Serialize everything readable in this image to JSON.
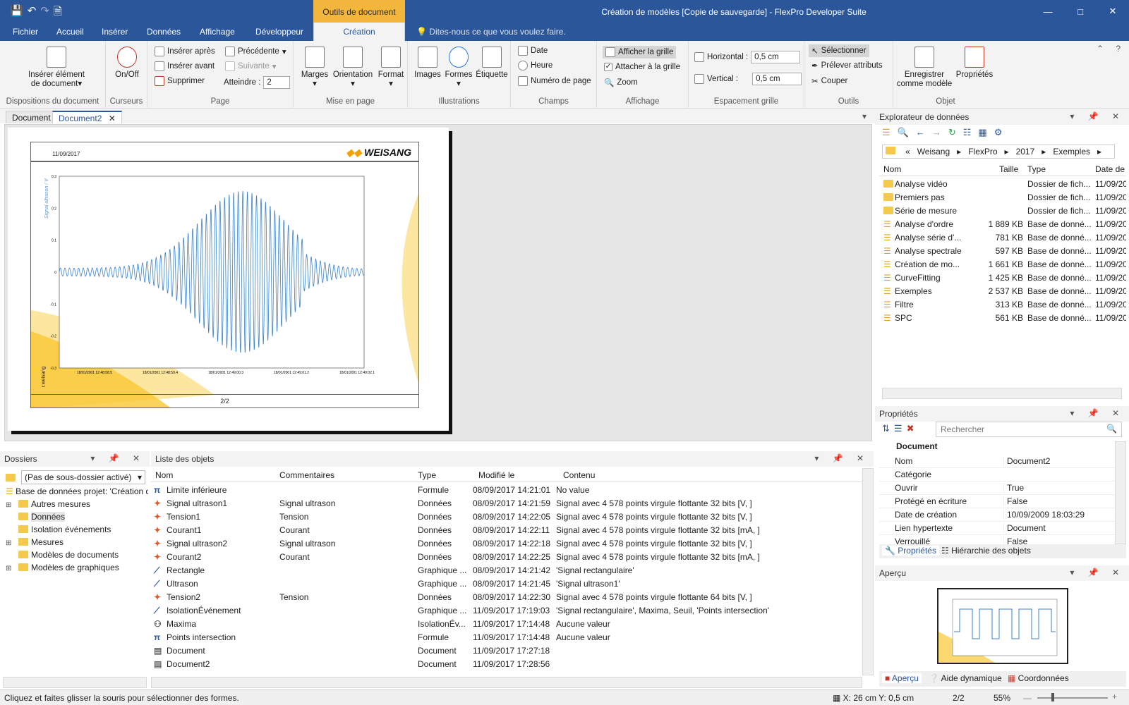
{
  "title_bar": {
    "title": "Création de modèles [Copie de sauvegarde] - FlexPro Developer Suite",
    "context_tab_group": "Outils de document"
  },
  "menu": {
    "items": [
      "Fichier",
      "Accueil",
      "Insérer",
      "Données",
      "Affichage",
      "Développeur"
    ],
    "active": "Création",
    "tell_me": "Dites-nous ce que vous voulez faire."
  },
  "ribbon": {
    "groups": {
      "dispositions": "Dispositions du document",
      "curseurs": "Curseurs",
      "page": "Page",
      "mise_en_page": "Mise en page",
      "illustrations": "Illustrations",
      "champs": "Champs",
      "affichage": "Affichage",
      "espacement": "Espacement grille",
      "outils": "Outils",
      "objet": "Objet"
    },
    "inserer_element": "Insérer élément",
    "de_document": "de document",
    "onoff": "On/Off",
    "inserer_apres": "Insérer après",
    "inserer_avant": "Insérer avant",
    "supprimer": "Supprimer",
    "precedente": "Précédente",
    "suivante": "Suivante",
    "atteindre": "Atteindre :",
    "atteindre_val": "2",
    "marges": "Marges",
    "orientation": "Orientation",
    "format": "Format",
    "images": "Images",
    "formes": "Formes",
    "etiquette": "Étiquette",
    "date": "Date",
    "heure": "Heure",
    "numero_page": "Numéro de page",
    "afficher_grille": "Afficher la grille",
    "attacher_grille": "Attacher à la grille",
    "zoom": "Zoom",
    "horizontal": "Horizontal :",
    "horizontal_val": "0,5 cm",
    "vertical": "Vertical :",
    "vertical_val": "0,5 cm",
    "selectionner": "Sélectionner",
    "prelever": "Prélever attributs",
    "couper": "Couper",
    "enregistrer": "Enregistrer",
    "comme_modele": "comme modèle",
    "proprietes": "Propriétés"
  },
  "doc_tabs": [
    "Document",
    "Document2"
  ],
  "document_page": {
    "date": "11/09/2017",
    "logo": "WEISANG",
    "page_number": "2/2",
    "side_text": "r.weisang",
    "y_axis_label": "Signal ultrason / V",
    "y_ticks": [
      "0.3",
      "0.2",
      "0.1",
      "0",
      "-0.1",
      "-0.2",
      "-0.3"
    ],
    "x_ticks": [
      "18/01/2001 12:48:58.5",
      "18/01/2001 12:48:59.4",
      "18/01/2001 12:49:00.3",
      "18/01/2001 12:49:01.2",
      "18/01/2001 12:49:02.1"
    ]
  },
  "data_explorer": {
    "title": "Explorateur de données",
    "path": [
      "«",
      "Weisang",
      "FlexPro",
      "2017",
      "Exemples"
    ],
    "columns": [
      "Nom",
      "Taille",
      "Type",
      "Date de"
    ],
    "rows": [
      {
        "name": "Analyse vidéo",
        "size": "",
        "type": "Dossier de fich...",
        "date": "11/09/20",
        "folder": true
      },
      {
        "name": "Premiers pas",
        "size": "",
        "type": "Dossier de fich...",
        "date": "11/09/20",
        "folder": true
      },
      {
        "name": "Série de mesure",
        "size": "",
        "type": "Dossier de fich...",
        "date": "11/09/20",
        "folder": true
      },
      {
        "name": "Analyse d'ordre",
        "size": "1 889 KB",
        "type": "Base de donné...",
        "date": "11/09/20",
        "folder": false
      },
      {
        "name": "Analyse série d'...",
        "size": "781 KB",
        "type": "Base de donné...",
        "date": "11/09/20",
        "folder": false
      },
      {
        "name": "Analyse spectrale",
        "size": "597 KB",
        "type": "Base de donné...",
        "date": "11/09/20",
        "folder": false
      },
      {
        "name": "Création de mo...",
        "size": "1 661 KB",
        "type": "Base de donné...",
        "date": "11/09/20",
        "folder": false
      },
      {
        "name": "CurveFitting",
        "size": "1 425 KB",
        "type": "Base de donné...",
        "date": "11/09/20",
        "folder": false
      },
      {
        "name": "Exemples",
        "size": "2 537 KB",
        "type": "Base de donné...",
        "date": "11/09/20",
        "folder": false
      },
      {
        "name": "Filtre",
        "size": "313 KB",
        "type": "Base de donné...",
        "date": "11/09/20",
        "folder": false
      },
      {
        "name": "SPC",
        "size": "561 KB",
        "type": "Base de donné...",
        "date": "11/09/20",
        "folder": false
      }
    ]
  },
  "properties": {
    "title": "Propriétés",
    "search_placeholder": "Rechercher",
    "section": "Document",
    "rows": [
      {
        "k": "Nom",
        "v": "Document2"
      },
      {
        "k": "Catégorie",
        "v": ""
      },
      {
        "k": "Ouvrir",
        "v": "True"
      },
      {
        "k": "Protégé en écriture",
        "v": "False"
      },
      {
        "k": "Date de création",
        "v": "10/09/2009 18:03:29"
      },
      {
        "k": "Lien hypertexte",
        "v": "Document"
      },
      {
        "k": "Verrouillé",
        "v": "False"
      }
    ],
    "tab_props": "Propriétés",
    "tab_hier": "Hiérarchie des objets"
  },
  "apercu": {
    "title": "Aperçu",
    "tab_apercu": "Aperçu",
    "tab_aide": "Aide dynamique",
    "tab_coord": "Coordonnées"
  },
  "folders": {
    "title": "Dossiers",
    "combo": "(Pas de sous-dossier activé)",
    "root": "Base de données projet: 'Création d",
    "items": [
      {
        "label": "Autres mesures",
        "expand": true
      },
      {
        "label": "Données",
        "expand": false
      },
      {
        "label": "Isolation événements",
        "expand": false
      },
      {
        "label": "Mesures",
        "expand": true
      },
      {
        "label": "Modèles de documents",
        "expand": false
      },
      {
        "label": "Modèles de graphiques",
        "expand": true
      }
    ]
  },
  "objects": {
    "title": "Liste des objets",
    "columns": [
      "Nom",
      "Commentaires",
      "Type",
      "Modifié le",
      "Contenu"
    ],
    "rows": [
      {
        "icon": "pi",
        "name": "Limite inférieure",
        "comment": "",
        "type": "Formule",
        "mod": "08/09/2017 14:21:01",
        "content": "No value"
      },
      {
        "icon": "sig",
        "name": "Signal ultrason1",
        "comment": "Signal ultrason",
        "type": "Données",
        "mod": "08/09/2017 14:21:59",
        "content": "Signal avec 4 578 points virgule flottante 32 bits [V, ]"
      },
      {
        "icon": "sig",
        "name": "Tension1",
        "comment": "Tension",
        "type": "Données",
        "mod": "08/09/2017 14:22:05",
        "content": "Signal avec 4 578 points virgule flottante 32 bits [V, ]"
      },
      {
        "icon": "sig",
        "name": "Courant1",
        "comment": "Courant",
        "type": "Données",
        "mod": "08/09/2017 14:22:11",
        "content": "Signal avec 4 578 points virgule flottante 32 bits [mA, ]"
      },
      {
        "icon": "sig",
        "name": "Signal ultrason2",
        "comment": "Signal ultrason",
        "type": "Données",
        "mod": "08/09/2017 14:22:18",
        "content": "Signal avec 4 578 points virgule flottante 32 bits [V, ]"
      },
      {
        "icon": "sig",
        "name": "Courant2",
        "comment": "Courant",
        "type": "Données",
        "mod": "08/09/2017 14:22:25",
        "content": "Signal avec 4 578 points virgule flottante 32 bits [mA, ]"
      },
      {
        "icon": "graph",
        "name": "Rectangle",
        "comment": "",
        "type": "Graphique ...",
        "mod": "08/09/2017 14:21:42",
        "content": "'Signal rectangulaire'"
      },
      {
        "icon": "graph",
        "name": "Ultrason",
        "comment": "",
        "type": "Graphique ...",
        "mod": "08/09/2017 14:21:45",
        "content": "'Signal ultrason1'"
      },
      {
        "icon": "sig",
        "name": "Tension2",
        "comment": "Tension",
        "type": "Données",
        "mod": "08/09/2017 14:22:30",
        "content": "Signal avec 4 578 points virgule flottante 64 bits [V, ]"
      },
      {
        "icon": "graph",
        "name": "IsolationÉvénement",
        "comment": "",
        "type": "Graphique ...",
        "mod": "11/09/2017 17:19:03",
        "content": "'Signal rectangulaire', Maxima, Seuil, 'Points intersection'"
      },
      {
        "icon": "iso",
        "name": "Maxima",
        "comment": "",
        "type": "IsolationÉv...",
        "mod": "11/09/2017 17:14:48",
        "content": "Aucune valeur"
      },
      {
        "icon": "pi",
        "name": "Points intersection",
        "comment": "",
        "type": "Formule",
        "mod": "11/09/2017 17:14:48",
        "content": "Aucune valeur"
      },
      {
        "icon": "doc",
        "name": "Document",
        "comment": "",
        "type": "Document",
        "mod": "11/09/2017 17:27:18",
        "content": ""
      },
      {
        "icon": "doc",
        "name": "Document2",
        "comment": "",
        "type": "Document",
        "mod": "11/09/2017 17:28:56",
        "content": ""
      }
    ]
  },
  "status": {
    "hint": "Cliquez et faites glisser la souris pour sélectionner des formes.",
    "coords": "X: 26 cm Y: 0,5 cm",
    "page": "2/2",
    "zoom": "55%"
  },
  "colors": {
    "accent": "#2b579a",
    "context": "#f2b63c",
    "signal": "#3b82c9"
  }
}
